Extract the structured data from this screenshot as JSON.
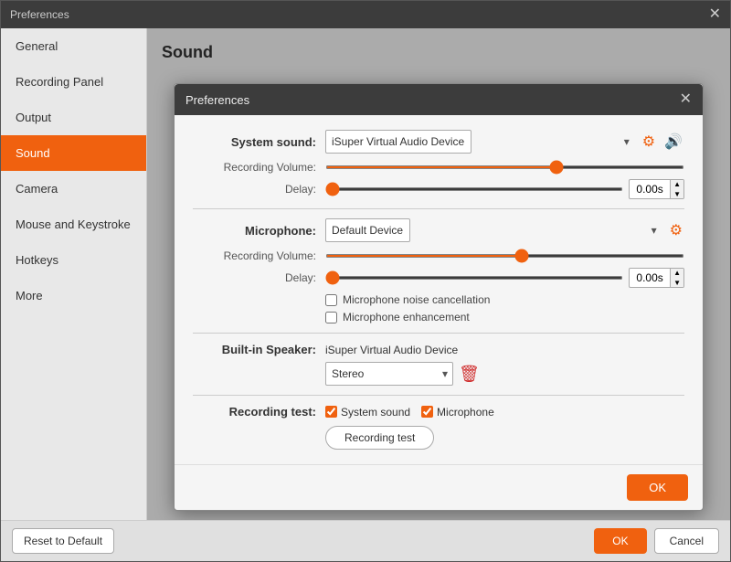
{
  "mainWindow": {
    "title": "Preferences",
    "closeBtn": "✕"
  },
  "sidebar": {
    "items": [
      {
        "id": "general",
        "label": "General",
        "active": false
      },
      {
        "id": "recording-panel",
        "label": "Recording Panel",
        "active": false
      },
      {
        "id": "output",
        "label": "Output",
        "active": false
      },
      {
        "id": "sound",
        "label": "Sound",
        "active": true
      },
      {
        "id": "camera",
        "label": "Camera",
        "active": false
      },
      {
        "id": "mouse-keystroke",
        "label": "Mouse and Keystroke",
        "active": false
      },
      {
        "id": "hotkeys",
        "label": "Hotkeys",
        "active": false
      },
      {
        "id": "more",
        "label": "More",
        "active": false
      }
    ]
  },
  "rightPanel": {
    "title": "Sound"
  },
  "modal": {
    "title": "Preferences",
    "closeBtn": "✕",
    "systemSound": {
      "label": "System sound:",
      "device": "iSuper Virtual Audio Device",
      "recordingVolumeLabel": "Recording Volume:",
      "delayLabel": "Delay:",
      "delayValue": "0.00s",
      "volumePercent": 65
    },
    "microphone": {
      "label": "Microphone:",
      "device": "Default Device",
      "recordingVolumeLabel": "Recording Volume:",
      "delayLabel": "Delay:",
      "delayValue": "0.00s",
      "volumePercent": 55,
      "noiseCancellation": "Microphone noise cancellation",
      "enhancement": "Microphone enhancement"
    },
    "builtInSpeaker": {
      "label": "Built-in Speaker:",
      "device": "iSuper Virtual Audio Device",
      "stereoLabel": "Stereo"
    },
    "recordingTest": {
      "label": "Recording test:",
      "systemSoundLabel": "System sound",
      "microphoneLabel": "Microphone",
      "buttonLabel": "Recording test"
    },
    "okBtn": "OK"
  },
  "bottomBar": {
    "resetBtn": "Reset to Default",
    "okBtn": "OK",
    "cancelBtn": "Cancel"
  }
}
